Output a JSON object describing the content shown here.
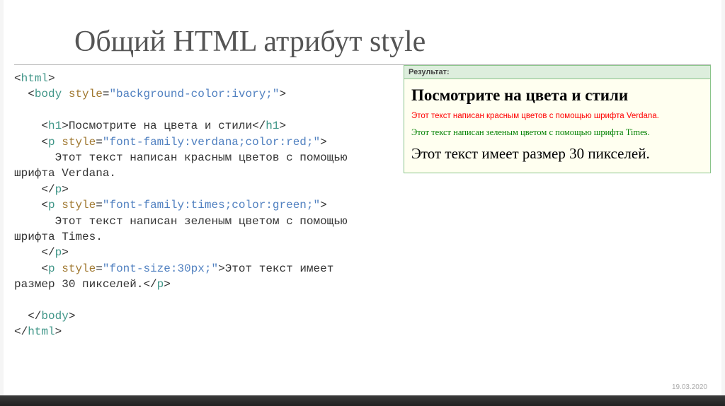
{
  "title": "Общий HTML атрибут style",
  "code": {
    "tag_html_open": "html",
    "tag_body_open": "body",
    "attr_style": "style",
    "val_body_style": "\"background-color:ivory;\"",
    "tag_h1": "h1",
    "h1_text": "Посмотрите на цвета и стили",
    "tag_p": "p",
    "val_p1_style": "\"font-family:verdana;color:red;\"",
    "p1_text_a": "      Этот текст написан красным цветов с помощью",
    "p1_text_b": "шрифта Verdana.",
    "val_p2_style": "\"font-family:times;color:green;\"",
    "p2_text_a": "      Этот текст написан зеленым цветом с помощью",
    "p2_text_b": "шрифта Times.",
    "val_p3_style": "\"font-size:30px;\"",
    "p3_text": "Этот текст имеет",
    "p3_text_b": "размер 30 пикселей."
  },
  "result": {
    "header": "Результат:",
    "h1": "Посмотрите на цвета и стили",
    "red": "Этот текст написан красным цветов с помощью шрифта Verdana.",
    "green": "Этот текст написан зеленым цветом с помощью шрифта Times.",
    "big": "Этот текст имеет размер 30 пикселей."
  },
  "footer_date": "19.03.2020"
}
